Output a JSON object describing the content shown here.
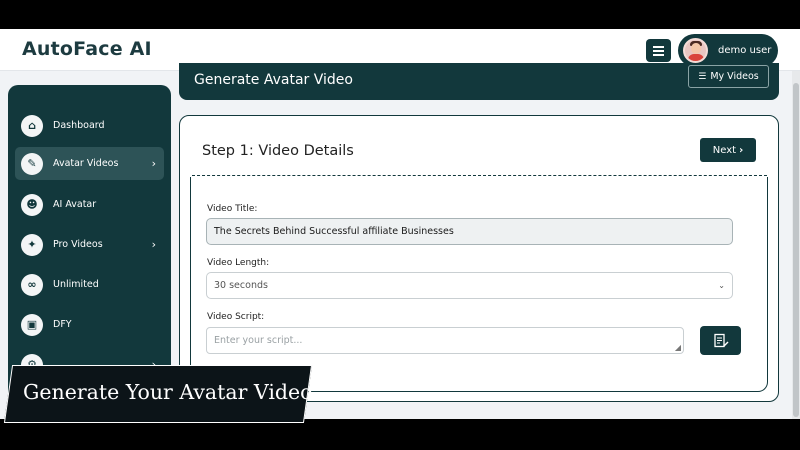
{
  "app": {
    "logo": "AutoFace AI"
  },
  "user": {
    "name": "demo user"
  },
  "sidebar": {
    "items": [
      {
        "label": "Dashboard",
        "icon": "home-icon",
        "glyph": "⌂",
        "has_chevron": false,
        "active": false
      },
      {
        "label": "Avatar Videos",
        "icon": "edit-icon",
        "glyph": "✎",
        "has_chevron": true,
        "active": true
      },
      {
        "label": "AI Avatar",
        "icon": "robot-icon",
        "glyph": "☻",
        "has_chevron": false,
        "active": false
      },
      {
        "label": "Pro Videos",
        "icon": "satellite-icon",
        "glyph": "✦",
        "has_chevron": true,
        "active": false
      },
      {
        "label": "Unlimited",
        "icon": "infinity-icon",
        "glyph": "∞",
        "has_chevron": false,
        "active": false
      },
      {
        "label": "DFY",
        "icon": "box-icon",
        "glyph": "▣",
        "has_chevron": false,
        "active": false
      }
    ]
  },
  "main": {
    "title": "Generate Avatar Video",
    "my_videos_label": "My Videos",
    "step_title": "Step 1: Video Details",
    "next_label": "Next",
    "fields": {
      "title_label": "Video Title:",
      "title_value": "The Secrets Behind Successful affiliate Businesses",
      "length_label": "Video Length:",
      "length_value": "30 seconds",
      "script_label": "Video Script:",
      "script_placeholder": "Enter your script..."
    }
  },
  "caption": {
    "text": "Generate Your Avatar Video"
  },
  "colors": {
    "primary": "#12383c",
    "active_item": "#2d5357",
    "background": "#f1f3f6"
  }
}
